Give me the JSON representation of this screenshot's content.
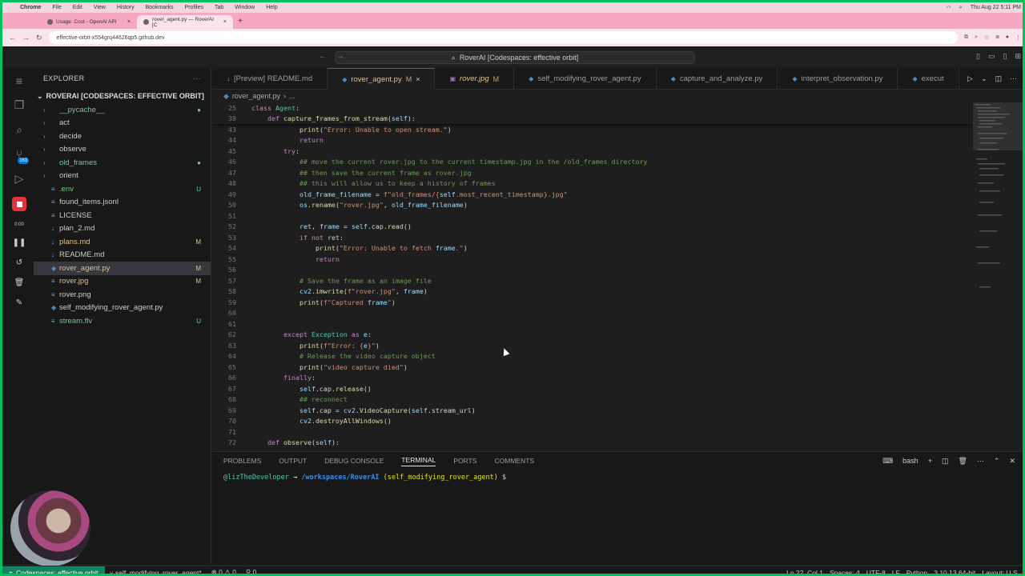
{
  "mac_menu": {
    "app": "Chrome",
    "items": [
      "File",
      "Edit",
      "View",
      "History",
      "Bookmarks",
      "Profiles",
      "Tab",
      "Window",
      "Help"
    ],
    "clock": "Thu Aug 22  5:11 PM"
  },
  "browser": {
    "tabs": [
      {
        "title": "Usage: Cost - OpenAI API"
      },
      {
        "title": "rover_agent.py — RoverAI [C"
      }
    ],
    "url": "effective-orbit-x554grq44626qp5.github.dev"
  },
  "vscode": {
    "command_center": "RoverAI [Codespaces: effective orbit]",
    "explorer_title": "EXPLORER",
    "workspace": "ROVERAI [CODESPACES: EFFECTIVE ORBIT]",
    "activity_badge": "163",
    "record_time": "0:00",
    "files": [
      {
        "name": "__pycache__",
        "type": "folder",
        "git": "",
        "color": "#73c991"
      },
      {
        "name": "act",
        "type": "folder",
        "git": "",
        "color": "#cccccc"
      },
      {
        "name": "decide",
        "type": "folder",
        "git": "",
        "color": "#cccccc"
      },
      {
        "name": "observe",
        "type": "folder",
        "git": "",
        "color": "#cccccc"
      },
      {
        "name": "old_frames",
        "type": "folder",
        "git": "",
        "color": "#73c991"
      },
      {
        "name": "orient",
        "type": "folder",
        "git": "",
        "color": "#cccccc"
      },
      {
        "name": ".env",
        "type": "file",
        "git": "U",
        "color": "#73c991"
      },
      {
        "name": "found_items.jsonl",
        "type": "file",
        "git": "",
        "color": "#cccccc"
      },
      {
        "name": "LICENSE",
        "type": "file",
        "git": "",
        "color": "#cccccc"
      },
      {
        "name": "plan_2.md",
        "type": "file",
        "git": "",
        "color": "#cccccc"
      },
      {
        "name": "plans.md",
        "type": "file",
        "git": "M",
        "color": "#e2c08d"
      },
      {
        "name": "README.md",
        "type": "file",
        "git": "",
        "color": "#cccccc"
      },
      {
        "name": "rover_agent.py",
        "type": "file",
        "git": "M",
        "color": "#e2c08d",
        "selected": true
      },
      {
        "name": "rover.jpg",
        "type": "file",
        "git": "M",
        "color": "#e2c08d"
      },
      {
        "name": "rover.png",
        "type": "file",
        "git": "",
        "color": "#cccccc"
      },
      {
        "name": "self_modifying_rover_agent.py",
        "type": "file",
        "git": "",
        "color": "#cccccc"
      },
      {
        "name": "stream.flv",
        "type": "file",
        "git": "U",
        "color": "#73c991"
      }
    ],
    "editor_tabs": [
      {
        "name": "[Preview] README.md",
        "modified": "",
        "active": false
      },
      {
        "name": "rover_agent.py",
        "modified": "M",
        "active": true
      },
      {
        "name": "rover.jpg",
        "modified": "M",
        "active": false,
        "italic": true
      },
      {
        "name": "self_modifying_rover_agent.py",
        "modified": "",
        "active": false
      },
      {
        "name": "capture_and_analyze.py",
        "modified": "",
        "active": false
      },
      {
        "name": "interpret_observation.py",
        "modified": "",
        "active": false
      },
      {
        "name": "execut",
        "modified": "",
        "active": false
      }
    ],
    "breadcrumbs": [
      "rover_agent.py",
      "..."
    ],
    "code_lines": [
      {
        "n": "25",
        "t": "class Agent:",
        "sticky": true
      },
      {
        "n": "38",
        "t": "    def capture_frames_from_stream(self):",
        "sticky": true
      },
      {
        "n": "43",
        "t": "            print(\"Error: Unable to open stream.\")"
      },
      {
        "n": "44",
        "t": "            return"
      },
      {
        "n": "45",
        "t": "        try:"
      },
      {
        "n": "46",
        "t": "            ## move the current rover.jpg to the current timestamp.jpg in the /old_frames directory"
      },
      {
        "n": "47",
        "t": "            ## then save the current frame as rover.jpg"
      },
      {
        "n": "48",
        "t": "            ## this will allow us to keep a history of frames"
      },
      {
        "n": "49",
        "t": "            old_frame_filename = f\"old_frames/{self.most_recent_timestamp}.jpg\""
      },
      {
        "n": "50",
        "t": "            os.rename(\"rover.jpg\", old_frame_filename)"
      },
      {
        "n": "51",
        "t": ""
      },
      {
        "n": "52",
        "t": "            ret, frame = self.cap.read()"
      },
      {
        "n": "53",
        "t": "            if not ret:"
      },
      {
        "n": "54",
        "t": "                print(\"Error: Unable to fetch frame.\")"
      },
      {
        "n": "55",
        "t": "                return"
      },
      {
        "n": "56",
        "t": ""
      },
      {
        "n": "57",
        "t": "            # Save the frame as an image file"
      },
      {
        "n": "58",
        "t": "            cv2.imwrite(f\"rover.jpg\", frame)"
      },
      {
        "n": "59",
        "t": "            print(f\"Captured frame\")"
      },
      {
        "n": "60",
        "t": ""
      },
      {
        "n": "61",
        "t": ""
      },
      {
        "n": "62",
        "t": "        except Exception as e:"
      },
      {
        "n": "63",
        "t": "            print(f\"Error: {e}\")"
      },
      {
        "n": "64",
        "t": "            # Release the video capture object"
      },
      {
        "n": "65",
        "t": "            print(\"video capture died\")"
      },
      {
        "n": "66",
        "t": "        finally:"
      },
      {
        "n": "67",
        "t": "            self.cap.release()"
      },
      {
        "n": "68",
        "t": "            ## reconnect"
      },
      {
        "n": "69",
        "t": "            self.cap = cv2.VideoCapture(self.stream_url)"
      },
      {
        "n": "70",
        "t": "            cv2.destroyAllWindows()"
      },
      {
        "n": "71",
        "t": ""
      },
      {
        "n": "72",
        "t": "    def observe(self):"
      }
    ],
    "panel_tabs": [
      "PROBLEMS",
      "OUTPUT",
      "DEBUG CONSOLE",
      "TERMINAL",
      "PORTS",
      "COMMENTS"
    ],
    "panel_active": "TERMINAL",
    "terminal_shell": "bash",
    "terminal": {
      "user": "@lizTheDeveloper",
      "arrow": "→",
      "path": "/workspaces/RoverAI",
      "branch": "(self_modifying_rover_agent)",
      "prompt": "$"
    },
    "status": {
      "remote": "Codespaces: effective orbit",
      "branch": "self_modifying_rover_agent*",
      "problems": "⊗ 0 ⚠ 0",
      "ports": "⚲ 0",
      "position": "Ln 22, Col 1",
      "spaces": "Spaces: 4",
      "encoding": "UTF-8",
      "eol": "LF",
      "language": "Python",
      "interpreter": "3.10.13 64-bit",
      "layout": "Layout: U.S."
    }
  }
}
